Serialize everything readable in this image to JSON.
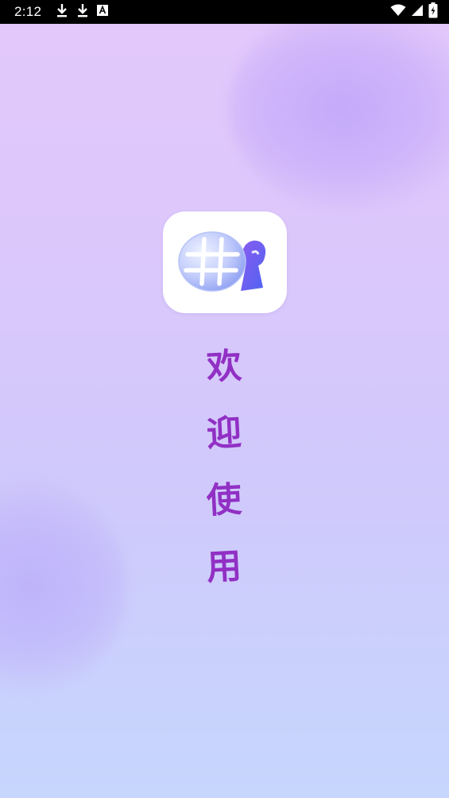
{
  "status_bar": {
    "time": "2:12",
    "left_icons": [
      "download-icon",
      "download-icon",
      "text-a-icon"
    ],
    "right_icons": [
      "wifi-icon",
      "cell-signal-icon",
      "battery-charging-icon"
    ]
  },
  "app_icon": {
    "name": "hashtag-globe-app-icon"
  },
  "welcome": {
    "chars": [
      "欢",
      "迎",
      "使",
      "用"
    ]
  },
  "colors": {
    "text_purple": "#9130c4",
    "bg_top": "#e3c8fb",
    "bg_bottom": "#c6d6fd",
    "status_bar": "#000000"
  }
}
